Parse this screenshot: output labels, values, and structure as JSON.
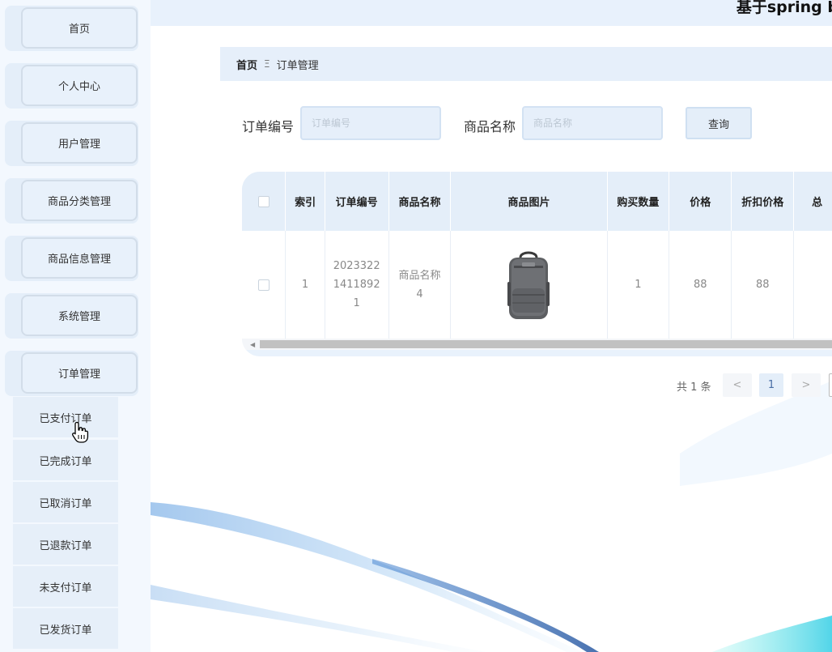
{
  "header": {
    "title": "基于spring b"
  },
  "sidebar": {
    "items": [
      {
        "label": "首页"
      },
      {
        "label": "个人中心"
      },
      {
        "label": "用户管理"
      },
      {
        "label": "商品分类管理"
      },
      {
        "label": "商品信息管理"
      },
      {
        "label": "系统管理"
      },
      {
        "label": "订单管理"
      }
    ],
    "submenu": [
      {
        "label": "已支付订单"
      },
      {
        "label": "已完成订单"
      },
      {
        "label": "已取消订单"
      },
      {
        "label": "已退款订单"
      },
      {
        "label": "未支付订单"
      },
      {
        "label": "已发货订单"
      }
    ]
  },
  "breadcrumb": {
    "home": "首页",
    "separator": "Ξ",
    "current": "订单管理"
  },
  "search": {
    "order_no_label": "订单编号",
    "order_no_placeholder": "订单编号",
    "product_name_label": "商品名称",
    "product_name_placeholder": "商品名称",
    "query_button": "查询"
  },
  "table": {
    "columns": [
      "索引",
      "订单编号",
      "商品名称",
      "商品图片",
      "购买数量",
      "价格",
      "折扣价格",
      "总"
    ],
    "rows": [
      {
        "index": "1",
        "order_no_lines": [
          "2023322",
          "1411892",
          "1"
        ],
        "product_name_lines": [
          "商品名称",
          "4"
        ],
        "image_icon": "backpack-icon",
        "quantity": "1",
        "price": "88",
        "discount_price": "88"
      }
    ]
  },
  "pagination": {
    "total_text": "共 1 条",
    "prev": "<",
    "page": "1",
    "next": ">"
  },
  "colors": {
    "sidebar_bg": "#f3f8fe",
    "menu_bg": "#e4eef9",
    "accent": "#e6effa"
  }
}
